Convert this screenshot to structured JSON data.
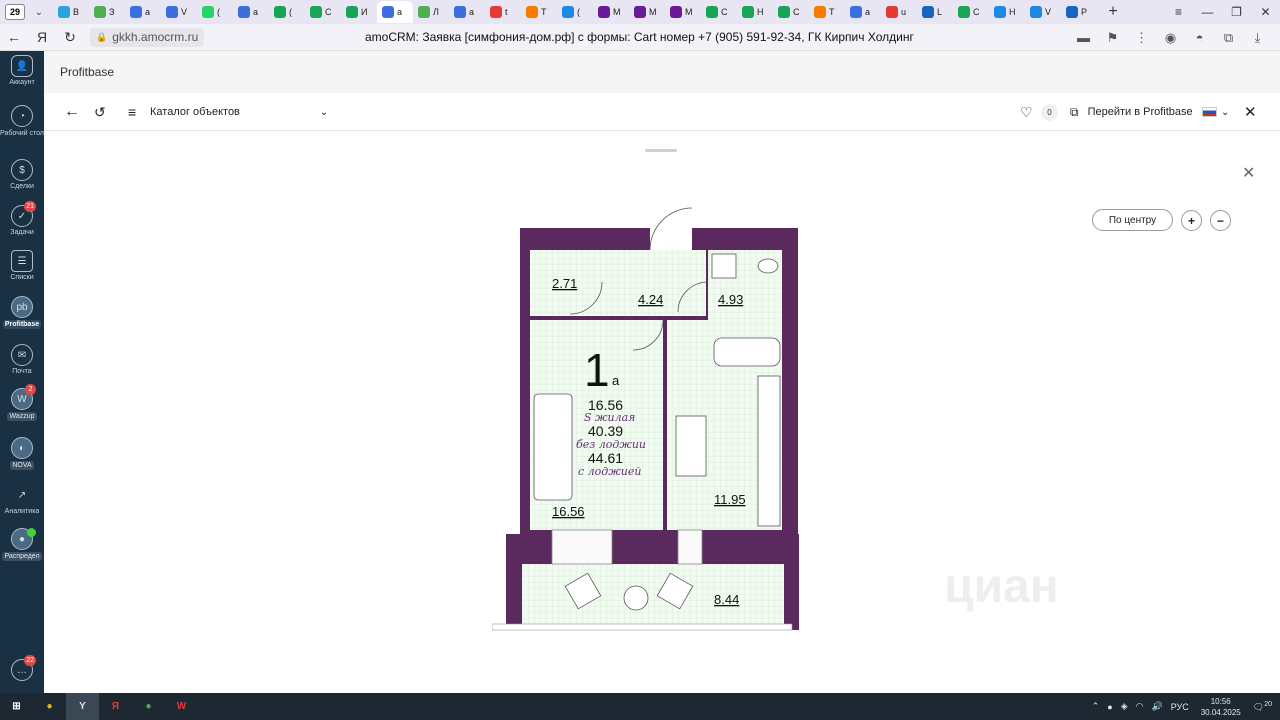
{
  "browser": {
    "tab_count": "29",
    "tabs": [
      {
        "label": "В",
        "icon": "telegram-icon",
        "color": "#2aa3e0"
      },
      {
        "label": "З",
        "icon": "puzzle-icon",
        "color": "#4caf50"
      },
      {
        "label": "a",
        "icon": "amocrm-icon",
        "color": "#3b6fe0"
      },
      {
        "label": "V",
        "icon": "amocrm-icon",
        "color": "#3b6fe0"
      },
      {
        "label": "(",
        "icon": "whatsapp-icon",
        "color": "#25d366"
      },
      {
        "label": "a",
        "icon": "amocrm-icon",
        "color": "#3b6fe0"
      },
      {
        "label": "(",
        "icon": "cian-icon",
        "color": "#18a558"
      },
      {
        "label": "С",
        "icon": "cian-icon",
        "color": "#18a558"
      },
      {
        "label": "И",
        "icon": "cian-icon",
        "color": "#18a558"
      },
      {
        "label": "a",
        "icon": "amocrm-icon",
        "color": "#3b6fe0"
      },
      {
        "label": "Л",
        "icon": "lenta-icon",
        "color": "#4caf50"
      },
      {
        "label": "a",
        "icon": "amocrm-icon",
        "color": "#3b6fe0"
      },
      {
        "label": "t",
        "icon": "yandex-icon",
        "color": "#e53935"
      },
      {
        "label": "T",
        "icon": "bars-icon",
        "color": "#f57c00"
      },
      {
        "label": "(",
        "icon": "chat-icon",
        "color": "#1e88e5"
      },
      {
        "label": "M",
        "icon": "m-icon",
        "color": "#6a1b9a"
      },
      {
        "label": "M",
        "icon": "m-icon",
        "color": "#6a1b9a"
      },
      {
        "label": "M",
        "icon": "m-icon",
        "color": "#6a1b9a"
      },
      {
        "label": "С",
        "icon": "cian-icon",
        "color": "#18a558"
      },
      {
        "label": "Н",
        "icon": "cian-icon",
        "color": "#18a558"
      },
      {
        "label": "С",
        "icon": "cian-icon",
        "color": "#18a558"
      },
      {
        "label": "T",
        "icon": "bars-icon",
        "color": "#f57c00"
      },
      {
        "label": "a",
        "icon": "amocrm-icon",
        "color": "#3b6fe0"
      },
      {
        "label": "u",
        "icon": "yandex-icon",
        "color": "#e53935"
      },
      {
        "label": "L",
        "icon": "l-icon",
        "color": "#1565c0"
      },
      {
        "label": "С",
        "icon": "cian-icon",
        "color": "#18a558"
      },
      {
        "label": "Н",
        "icon": "h-icon",
        "color": "#1e88e5"
      },
      {
        "label": "V",
        "icon": "chat-icon",
        "color": "#1e88e5"
      },
      {
        "label": "P",
        "icon": "p-icon",
        "color": "#1565c0"
      }
    ],
    "url": "gkkh.amocrm.ru",
    "page_title": "amoCRM: Заявка [симфония-дом.рф] с формы: Cart номер +7 (905) 591-92-34, ГК Кирпич Холдинг"
  },
  "sidebar": {
    "items": [
      {
        "label": "Аккаунт"
      },
      {
        "label": "Рабочий стол"
      },
      {
        "label": "Сделки"
      },
      {
        "label": "Задачи",
        "badge": "21"
      },
      {
        "label": "Списки"
      },
      {
        "label": "Profitbase"
      },
      {
        "label": "Почта"
      },
      {
        "label": "Wazzup",
        "badge": "2"
      },
      {
        "label": "NOVA"
      },
      {
        "label": "Аналитика"
      },
      {
        "label": "Распредел"
      }
    ],
    "chat_badge": "22"
  },
  "header": {
    "brand": "Profitbase"
  },
  "toolbar": {
    "catalog_label": "Каталог объектов",
    "favorites_count": "0",
    "goto_label": "Перейти в Profitbase"
  },
  "viewer": {
    "center_label": "По центру",
    "zoom_in": "+",
    "zoom_out": "−",
    "watermark": "циан"
  },
  "plan": {
    "rooms_big": "1",
    "rooms_suffix": "а",
    "living_area": "16.56",
    "living_label": "S жилая",
    "total_area": "40.39",
    "total_label": "без лоджии",
    "total_loggia": "44.61",
    "loggia_label": "с лоджией",
    "areas": {
      "storage": "2.71",
      "hall": "4.24",
      "bath": "4.93",
      "room": "16.56",
      "kitchen": "11.95",
      "loggia": "8.44"
    },
    "wall_color": "#5a2a5e",
    "grid_color": "#d9efd9"
  },
  "taskbar": {
    "apps": [
      {
        "name": "windows-start-icon",
        "color": "#ffffff",
        "glyph": "⊞"
      },
      {
        "name": "chrome-icon",
        "color": "#e9b90a",
        "glyph": "●"
      },
      {
        "name": "yandex-browser-icon",
        "color": "#e0e0e0",
        "glyph": "Y"
      },
      {
        "name": "yandex-icon",
        "color": "#e53935",
        "glyph": "Я"
      },
      {
        "name": "chrome-icon",
        "color": "#4caf50",
        "glyph": "●"
      },
      {
        "name": "app-icon",
        "color": "#e53935",
        "glyph": "W"
      }
    ],
    "lang": "РУС",
    "time": "10:56",
    "date": "30.04.2025",
    "notifications": "20"
  }
}
